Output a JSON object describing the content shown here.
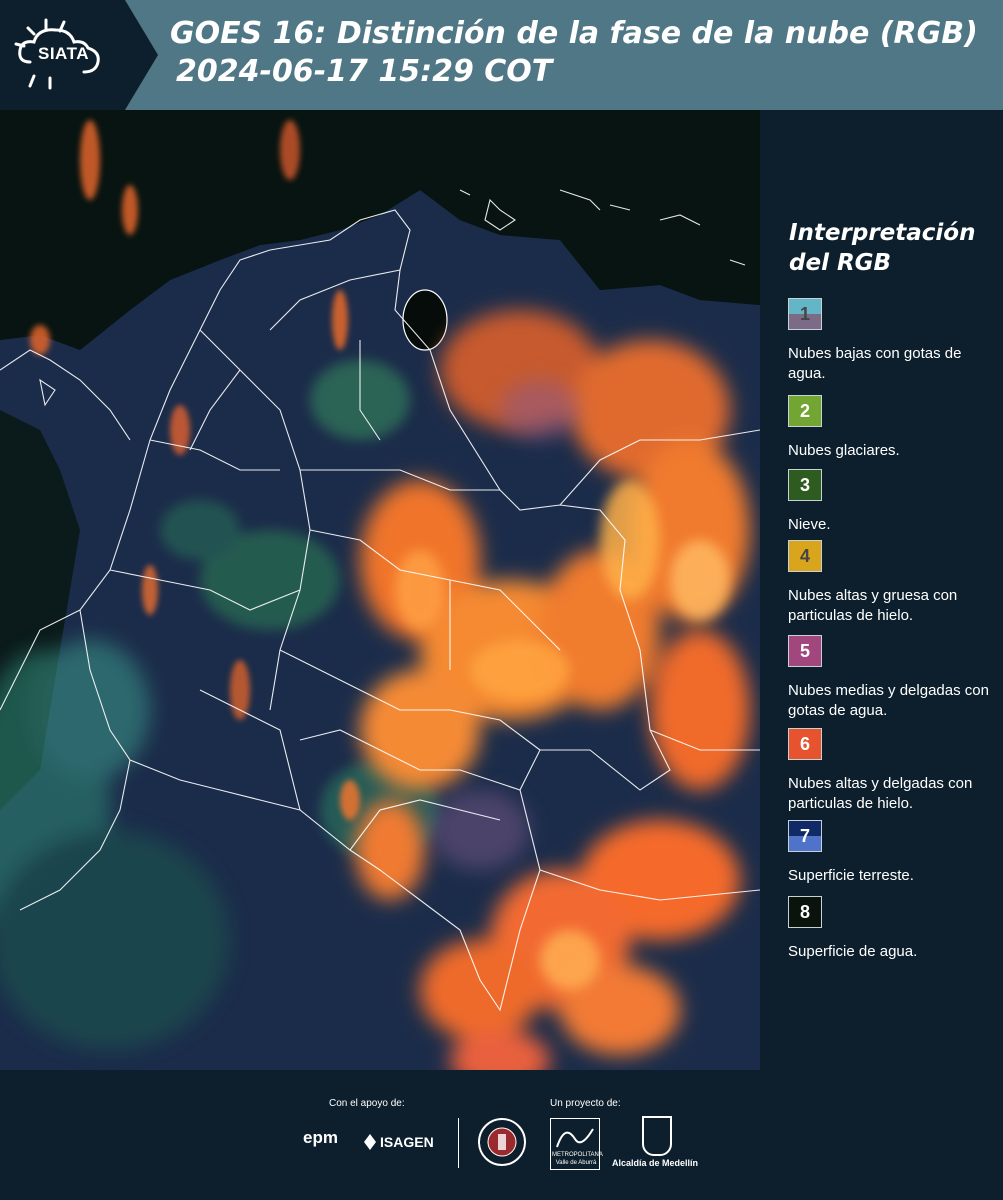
{
  "header": {
    "logo_text": "SIATA",
    "title": "GOES 16: Distinción de la fase de la nube (RGB)",
    "subtitle": "2024-06-17 15:29 COT",
    "bg_color": "#4f7785"
  },
  "legend": {
    "title": "Interpretación del RGB",
    "items": [
      {
        "number": "1",
        "label": "Nubes bajas con gotas de agua.",
        "color_top": "#63b6c5",
        "color_bottom": "#7b6b87",
        "number_color": "#444444"
      },
      {
        "number": "2",
        "label": "Nubes glaciares.",
        "color_top": "#73a533",
        "color_bottom": "#73a533",
        "number_color": "#ffffff"
      },
      {
        "number": "3",
        "label": "Nieve.",
        "color_top": "#2e5b1f",
        "color_bottom": "#2e5b1f",
        "number_color": "#ffffff"
      },
      {
        "number": "4",
        "label": "Nubes altas y gruesa con particulas de hielo.",
        "color_top": "#d9a51d",
        "color_bottom": "#d9a51d",
        "number_color": "#444444"
      },
      {
        "number": "5",
        "label": "Nubes medias y delgadas con gotas de agua.",
        "color_top": "#a2467e",
        "color_bottom": "#a2467e",
        "number_color": "#ffffff"
      },
      {
        "number": "6",
        "label": "Nubes altas y delgadas con particulas de hielo.",
        "color_top": "#e8532f",
        "color_bottom": "#e8532f",
        "number_color": "#ffffff"
      },
      {
        "number": "7",
        "label": "Superficie terreste.",
        "color_top": "#0f2a66",
        "color_bottom": "#4f73c8",
        "number_color": "#ffffff"
      },
      {
        "number": "8",
        "label": "Superficie de agua.",
        "color_top": "#0a140c",
        "color_bottom": "#0a140c",
        "number_color": "#ffffff"
      }
    ]
  },
  "footer": {
    "support_label": "Con el apoyo de:",
    "project_label": "Un proyecto de:",
    "epm": "epm",
    "isagen": "ISAGEN",
    "area": "METROPOLITANA",
    "area_sub": "Valle de Aburrá",
    "alcaldia": "Alcaldía de Medellín"
  },
  "map": {
    "colors": {
      "land": "#1b2c4a",
      "water": "#07120f",
      "cloud_orange": "#f06a2a",
      "cloud_bright": "#ff9b3c",
      "cloud_green": "#2f8a55",
      "cloud_cyan": "#4fb8a8",
      "border": "#ffffff"
    }
  }
}
